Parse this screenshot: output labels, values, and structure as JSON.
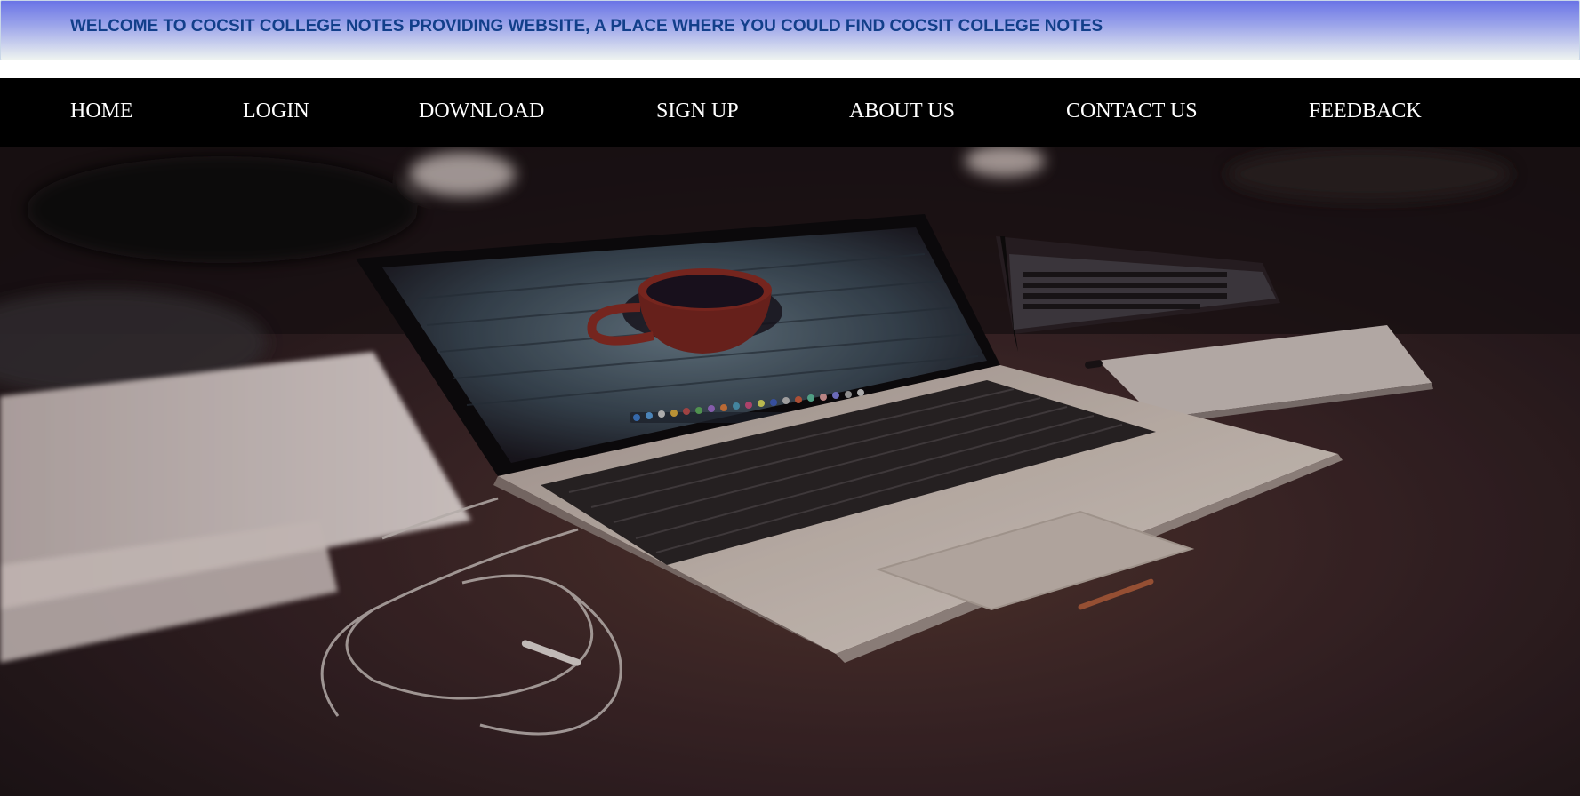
{
  "banner": {
    "text": "WELCOME TO COCSIT COLLEGE NOTES PROVIDING WEBSITE, A PLACE WHERE YOU COULD FIND COCSIT COLLEGE NOTES"
  },
  "nav": {
    "items": [
      {
        "label": "HOME"
      },
      {
        "label": "LOGIN"
      },
      {
        "label": "DOWNLOAD"
      },
      {
        "label": "SIGN UP"
      },
      {
        "label": "ABOUT US"
      },
      {
        "label": "CONTACT US"
      },
      {
        "label": "FEEDBACK"
      }
    ]
  },
  "hero": {
    "image": "laptop-on-desk-with-coffee-cup-wallpaper"
  },
  "colors": {
    "banner_text": "#123f8a",
    "nav_background": "#000000",
    "nav_text": "#ffffff"
  }
}
